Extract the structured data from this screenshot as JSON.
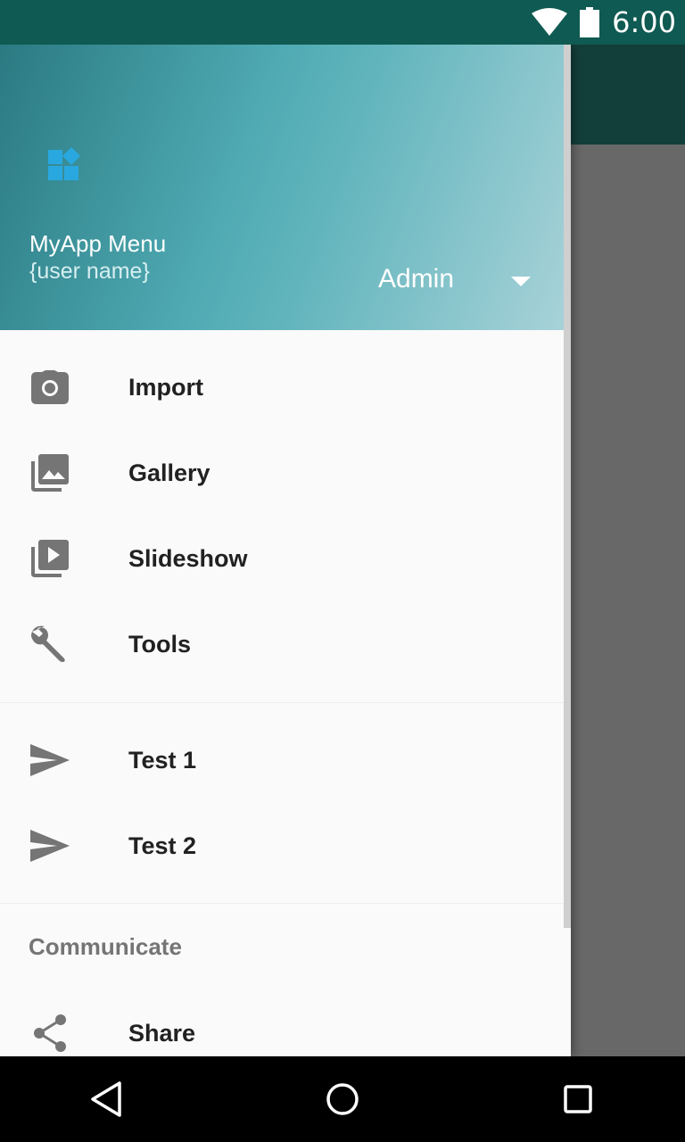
{
  "status_bar": {
    "time": "6:00",
    "icons": [
      "wifi-icon",
      "battery-icon"
    ]
  },
  "drawer": {
    "header": {
      "title": "MyApp Menu",
      "subtitle": "{user name}",
      "account_role": "Admin",
      "logo_icon": "widgets-icon",
      "colors": {
        "gradient_start": "#2B7A82",
        "gradient_end": "#A9D3D9",
        "logo": "#29A8E0"
      }
    },
    "items": [
      {
        "label": "Import",
        "icon": "camera-icon"
      },
      {
        "label": "Gallery",
        "icon": "gallery-icon"
      },
      {
        "label": "Slideshow",
        "icon": "slideshow-icon"
      },
      {
        "label": "Tools",
        "icon": "wrench-icon"
      }
    ],
    "items_group2": [
      {
        "label": "Test 1",
        "icon": "send-icon"
      },
      {
        "label": "Test 2",
        "icon": "send-icon"
      }
    ],
    "section": {
      "header": "Communicate",
      "items": [
        {
          "label": "Share",
          "icon": "share-icon"
        }
      ]
    }
  },
  "nav_bar": {
    "buttons": [
      "back-icon",
      "home-icon",
      "recents-icon"
    ]
  },
  "colors": {
    "status_bar": "#0F5A52",
    "app_toolbar": "#133F3B",
    "icon_gray": "#757575"
  }
}
